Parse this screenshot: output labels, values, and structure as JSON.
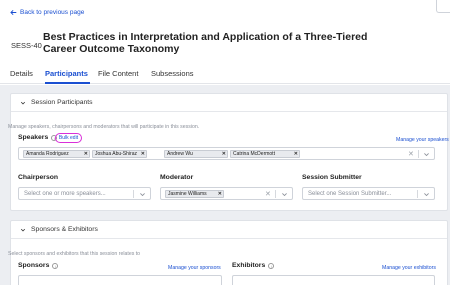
{
  "nav": {
    "back_label": "Back to previous page"
  },
  "header": {
    "session_id": "SESS-40",
    "title": "Best Practices in Interpretation and Application of a Three-Tiered Career Outcome Taxonomy"
  },
  "tabs": [
    {
      "label": "Details",
      "active": false
    },
    {
      "label": "Participants",
      "active": true
    },
    {
      "label": "File Content",
      "active": false
    },
    {
      "label": "Subsessions",
      "active": false
    }
  ],
  "participants": {
    "heading": "Session Participants",
    "description": "Manage speakers, chairpersons and moderators that will participate in this session.",
    "speakers": {
      "label": "Speakers",
      "bulk_edit": "Bulk edit",
      "manage_link": "Manage your speakers",
      "chips": [
        "Amanda Rodriguez",
        "Joshua Abu-Shiraz",
        "Andrew Wu",
        "Catrina McDermott"
      ]
    },
    "chairperson": {
      "label": "Chairperson",
      "placeholder": "Select one or more speakers..."
    },
    "moderator": {
      "label": "Moderator",
      "chips": [
        "Jasmine Williams"
      ]
    },
    "submitter": {
      "label": "Session Submitter",
      "placeholder": "Select one Session Submitter..."
    }
  },
  "sponsors": {
    "heading": "Sponsors & Exhibitors",
    "description": "Select sponsors and exhibitors that this session relates to",
    "sponsors_label": "Sponsors",
    "sponsors_manage": "Manage your sponsors",
    "exhibitors_label": "Exhibitors",
    "exhibitors_manage": "Manage your exhibitors"
  },
  "colors": {
    "accent": "#1a4fd1",
    "highlight": "#d92fd9",
    "canvas": "#eceef2"
  }
}
